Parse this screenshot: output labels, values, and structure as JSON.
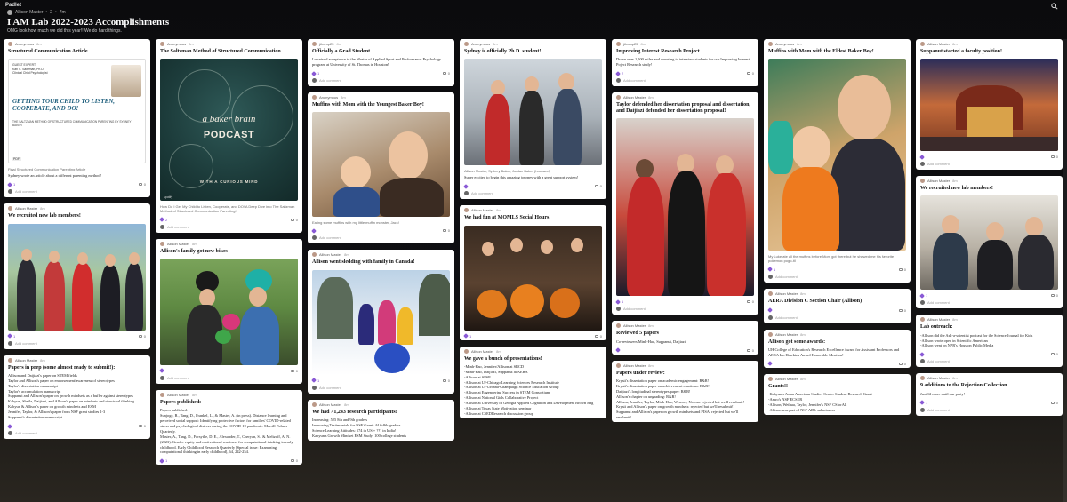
{
  "app": {
    "brand": "Padlet"
  },
  "header": {
    "crumb_owner": "Allison Master",
    "crumb_sep": "•",
    "crumb_count": "2",
    "crumb_time": "7m",
    "title": "I AM Lab 2022-2023 Accomplishments",
    "subtitle": "OMG look how much we did this year!! We do hard things."
  },
  "ui": {
    "add_comment": "Add comment"
  },
  "columns": [
    {
      "cards": [
        {
          "author": "Anonymous",
          "time": "8m",
          "title": "Structured Communication Article",
          "doc": {
            "guest_label": "GUEST EXPERT",
            "guest_name": "Karl S. Saltzman, Ph.D.",
            "guest_role": "Clinical Child Psychologist",
            "headline": "GETTING YOUR CHILD TO LISTEN, COOPERATE, AND DO!",
            "sub": "THE SALTZMAN METHOD OF STRUCTURED COMMUNICATION PARENTING BY SYDNEY BAKER",
            "tag": "PDF"
          },
          "caption": "Final Structured Communication Parenting Article",
          "body": [
            "Sydney wrote an article about a different parenting method!"
          ],
          "likes": "1",
          "comments": "0"
        },
        {
          "author": "Allison Master",
          "time": "8m",
          "title": "We recruited new lab members!",
          "likes": "1",
          "comments": "0"
        },
        {
          "author": "Allison Master",
          "time": "8m",
          "title": "Papers in prep (some almost ready to submit!):",
          "body": [
            "Allison and Daijiazi's paper on STEM fields",
            "Taylor and Allison's paper on endorsement/awareness of stereotypes",
            "Taylor's dissertation manuscript",
            "Taylor's accumulation manuscript",
            "Suppanut and Allison's paper on growth mindsets as a buffer against stereotypes",
            "Kabyun, Sheila, Daijiazi, and Allison's paper on mindsets and structural thinking",
            "Kabyun & Allison's paper on growth mindsets and ESM",
            "Jennifer, Taylor, & Allison's paper from NSF grant studies 1-3",
            "Suppanut's dissertation manuscript"
          ],
          "likes": "",
          "comments": "0"
        }
      ]
    },
    {
      "cards": [
        {
          "author": "Anonymous",
          "time": "8m",
          "title": "The Saltzman Method of Structured Communication",
          "podcast": {
            "line1": "a baker brain",
            "line2": "PODCAST",
            "line3": "WITH A CURIOUS MIND",
            "tag": "spotify"
          },
          "caption": "How Do I Get My Child to Listen, Cooperate, and DO! A Deep Dive into The Saltzman Method of Structured Communication Parenting!",
          "likes": "2",
          "comments": "0"
        },
        {
          "author": "Allison Master",
          "time": "8m",
          "title": "Allison's family got new bikes",
          "likes": "",
          "comments": "0"
        },
        {
          "author": "Allison Master",
          "time": "8m",
          "title": "Papers published:",
          "body": [
            "Papers published:",
            "Sunjoge, R., Tang, D., Frankel, L., & Master, A. (in press). Distance learning and perceived social support: Identifying protective factors for families' COVID-related stress and psychological distress during the COVID-19 pandemic. Merrill-Palmer Quarterly.",
            "Master, A., Tang, D., Forsythe, D. E., Alexander, T., Cheryan, S., & Meltzoff, A. N. (2023). Gender equity and motivational readiness for computational thinking in early childhood. Early Childhood Research Quarterly [Special issue: Examining computational thinking in early childhood], 64, 242-254."
          ],
          "likes": "1",
          "comments": "0"
        }
      ]
    },
    {
      "cards": [
        {
          "author": "jthomp25",
          "time": "8m",
          "title": "Officially a Grad Student",
          "body": [
            "I received acceptance to the Master of Applied Sport and Performance Psychology program at University of St. Thomas in Houston!"
          ],
          "likes": "1",
          "comments": "0"
        },
        {
          "author": "Anonymous",
          "time": "8m",
          "title": "Muffins with Mom with the Youngest Baker Boy!",
          "caption": "Eating some muffins with my little muffin monster, Jack!",
          "likes": "",
          "comments": "0"
        },
        {
          "author": "Allison Master",
          "time": "8m",
          "title": "Allison went sledding with family in Canada!",
          "likes": "1",
          "comments": "0"
        },
        {
          "author": "Allison Master",
          "time": "8m",
          "title": "We had >1,243 research participants!",
          "body": [
            "Increasing: 525 8th and 9th graders",
            "Improving Testimonials for NSF Grant: 44 6-8th graders",
            "Science Learning Attitudes: 574 in US + ??? in India!",
            "Kabyun's Growth Mindset ESM Study: 100 college students"
          ],
          "likes": "",
          "comments": "0"
        }
      ]
    },
    {
      "cards": [
        {
          "author": "Anonymous",
          "time": "8m",
          "title": "Sydney is officially Ph.D. student!",
          "caption": "Allison Master, Sydney Baker, Jordan Baker (husband)",
          "body": [
            "Super excited to begin this amazing journey with a great support system!"
          ],
          "likes": "",
          "comments": "0"
        },
        {
          "author": "Allison Master",
          "time": "8m",
          "title": "We had fun at MQMLS Social Hours!",
          "likes": "1",
          "comments": "0"
        },
        {
          "author": "Allison Master",
          "time": "8m",
          "title": "We gave a bunch of presentations!",
          "body": [
            "-Minh-Hao, Jennifer/Allison at SRCD",
            "-Minh-Hao, Daijiazi, Suppanut at AERA",
            "-Allison at SPSP",
            "-Allison at UJ-Chicago Learning Sciences Research Institute",
            "-Allison at UI-Urbana-Champaign Science Education Group",
            "-Allison at Engendering Success in STEM Consortium",
            "-Allison at National Girls Collaborative Project",
            "-Allison at University of Georgia Applied Cognition and Development Brown Bag",
            "-Allison at Texas State Motivation seminar",
            "-Allison at CSEDResearch discussion group"
          ],
          "likes": "",
          "comments": "0"
        }
      ]
    },
    {
      "cards": [
        {
          "author": "jthomp25",
          "time": "8m",
          "title": "Improving Interest Research Project",
          "body": [
            "Drove over 1,500 miles and counting to interview students for our Improving Interest Poject Research study!"
          ],
          "likes": "2",
          "comments": "0"
        },
        {
          "author": "Allison Master",
          "time": "8m",
          "title": "Taylor defended her dissertation proposal and dissertation, and Daijiazi defended her dissertation proposal!",
          "likes": "1",
          "comments": "0"
        },
        {
          "author": "Allison Master",
          "time": "8m",
          "title": "Reviewed 5 papers",
          "body": [
            "Co-reviewers Minh-Hao, Suppanut, Daijiazi"
          ],
          "likes": "",
          "comments": "0"
        },
        {
          "author": "Allison Master",
          "time": "8m",
          "title": "Papers under review:",
          "body": [
            "Krysti's dissertation paper on academic engagement: R&R!",
            "Krysti's dissertation paper on achievement emotions: R&R!",
            "Daijiazi's longitudinal stereotypes paper: R&R!",
            "Allison's chapter on ungrading: R&R!",
            "Allison, Jennifer, Taylor, Minh-Hao, Wenwei, Norma: rejected but we'll resubmit!",
            "Krysti and Allison's paper on growth mindsets: rejected but we'll resubmit!",
            "Suppanut and Allison's paper on growth mindsets and PISA: rejected but we'll resubmit!"
          ],
          "likes": "1",
          "comments": "0"
        }
      ]
    },
    {
      "cards": [
        {
          "author": "Anonymous",
          "time": "8m",
          "title": "Muffins with Mom with the Eldest Baker Boy!",
          "caption": "My Luke ate all the muffins before Mom got there but he showed me his favorite pokemon pogo-itl",
          "likes": "1",
          "comments": "0"
        },
        {
          "author": "Allison Master",
          "time": "8m",
          "title": "AERA Division C Section Chair (Allison)",
          "likes": "",
          "comments": "0"
        },
        {
          "author": "Allison Master",
          "time": "8m",
          "title": "Allison got some awards:",
          "body": [
            "UH College of Education's Research Excellence Award for Assistant Professors and AERA Ian Hawkins Award Honorable Mention!"
          ],
          "likes": "",
          "comments": "0"
        },
        {
          "author": "Allison Master",
          "time": "8m",
          "title": "Grants!!",
          "body": [
            "-Kabyun's Asian American Studies Center Student Research Grant",
            "-Amro's NSF ECSER",
            "-Allison, Weihua, Taylor, Jennifer's NSF CSforAll",
            "-Allison was part of NSF ADL submission"
          ],
          "likes": "",
          "comments": "0"
        }
      ]
    },
    {
      "cards": [
        {
          "author": "Allison Master",
          "time": "8m",
          "title": "Suppanut started a faculty position!",
          "likes": "",
          "comments": "0"
        },
        {
          "author": "Allison Master",
          "time": "8m",
          "title": "We recruited new lab members!",
          "likes": "1",
          "comments": "0"
        },
        {
          "author": "Allison Master",
          "time": "8m",
          "title": "Lab outreach:",
          "body": [
            "-Allison did the Ask-a-scientist podcast for the Science Journal for Kids",
            "-Allison wrote oped in Scientific American",
            "-Allison went on NPR's Houston Public Media"
          ],
          "likes": "",
          "comments": "0"
        },
        {
          "author": "Allison Master",
          "time": "8m",
          "title": "9 additions to the Rejection Collection",
          "body": [
            "Just 12 more until our party!"
          ],
          "likes": "1",
          "comments": "0"
        }
      ]
    }
  ],
  "colors": {
    "accent": "#7a4cc4",
    "background": "#0f0f12",
    "card": "#ffffff"
  },
  "icons": {
    "search": "search-icon",
    "like": "heart-icon",
    "comment": "comment-icon"
  }
}
